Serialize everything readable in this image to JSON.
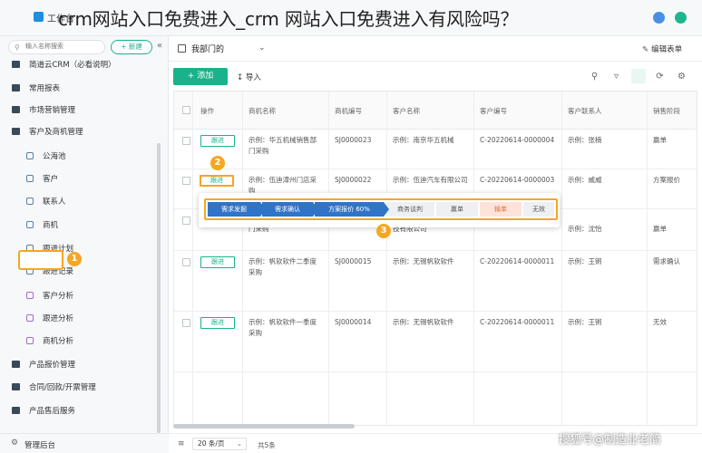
{
  "article_title": "crm网站入口免费进入_crm 网站入口免费进入有风险吗？",
  "app": {
    "title": "工作台"
  },
  "sidebar": {
    "search_placeholder": "输入名称搜索",
    "new_label": "+ 新建",
    "collapse_label": "«",
    "items": [
      {
        "label": "简道云CRM（必看说明）",
        "level": "top"
      },
      {
        "label": "常用报表",
        "level": "top"
      },
      {
        "label": "市场营销管理",
        "level": "top"
      },
      {
        "label": "客户及商机管理",
        "level": "top"
      },
      {
        "label": "公海池",
        "level": "sub"
      },
      {
        "label": "客户",
        "level": "sub"
      },
      {
        "label": "联系人",
        "level": "sub"
      },
      {
        "label": "商机",
        "level": "sub",
        "active": true
      },
      {
        "label": "跟进计划",
        "level": "sub"
      },
      {
        "label": "跟进记录",
        "level": "sub"
      },
      {
        "label": "客户分析",
        "level": "sub",
        "chart": true
      },
      {
        "label": "跟进分析",
        "level": "sub",
        "chart": true
      },
      {
        "label": "商机分析",
        "level": "sub",
        "chart": true
      },
      {
        "label": "产品报价管理",
        "level": "top"
      },
      {
        "label": "合同/回款/开票管理",
        "level": "top"
      },
      {
        "label": "产品售后服务",
        "level": "top"
      }
    ],
    "footer_label": "管理后台",
    "badge1": "1"
  },
  "main": {
    "view_label": "我部门的",
    "edit_label": "编辑表单",
    "add_label": "+ 添加",
    "import_label": "导入",
    "columns": [
      "操作",
      "商机名称",
      "商机编号",
      "客户名称",
      "客户编号",
      "客户联系人",
      "销售阶段"
    ],
    "followup_label": "跟进",
    "rows": [
      {
        "name": "示例：华五机械销售部门采购",
        "code": "SJ0000023",
        "customer": "示例：南京华五机械",
        "cust_code": "C-20220614-0000004",
        "contact": "示例：张楠",
        "stage": "赢单"
      },
      {
        "name": "示例：伍迪漳州门店采购",
        "code": "SJ0000022",
        "customer": "示例：伍迪汽车有限公司",
        "cust_code": "C-20220614-0000003",
        "contact": "示例：威威",
        "stage": "方案报价"
      },
      {
        "name": "门采购",
        "code": "",
        "customer": "技有限公司",
        "cust_code": "",
        "contact": "示例：沈怡",
        "stage": "赢单"
      },
      {
        "name": "示例：帆软软件二季度采购",
        "code": "SJ0000015",
        "customer": "示例：无锡帆软软件",
        "cust_code": "C-20220614-0000011",
        "contact": "示例：王锵",
        "stage": "需求确认"
      },
      {
        "name": "示例：帆软软件一季度采购",
        "code": "SJ0000014",
        "customer": "示例：无锡帆软软件",
        "cust_code": "C-20220614-0000011",
        "contact": "示例：王锵",
        "stage": "无效"
      }
    ],
    "stages": [
      {
        "label": "需求发掘",
        "state": "done"
      },
      {
        "label": "需求确认",
        "state": "done"
      },
      {
        "label": "方案报价 60%",
        "state": "done"
      },
      {
        "label": "商务谈判",
        "state": "pend"
      },
      {
        "label": "赢单",
        "state": "pend"
      },
      {
        "label": "输单",
        "state": "lose"
      },
      {
        "label": "无效",
        "state": "pend"
      }
    ],
    "badge2": "2",
    "badge3": "3",
    "page_size": "20 条/页",
    "total": "共5条"
  },
  "watermark": "搜狐号@制造业老简"
}
